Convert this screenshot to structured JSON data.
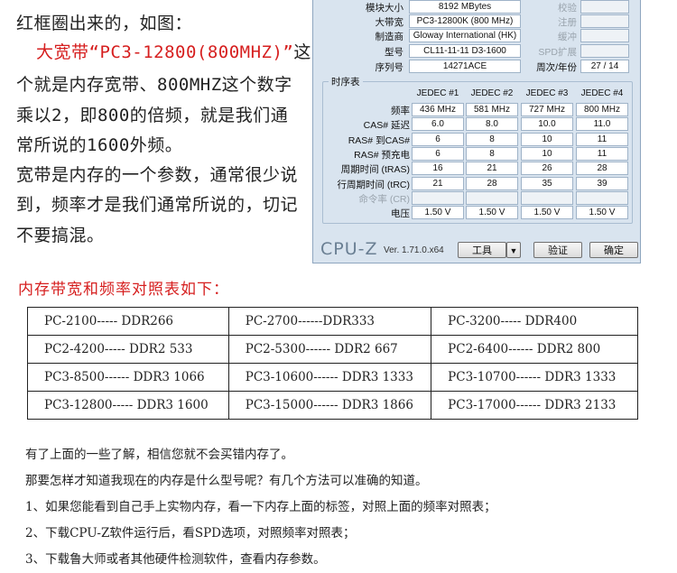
{
  "intro": {
    "line1": "红框圈出来的，如图：",
    "line2_highlight": "大宽带",
    "line2_quote": "“PC3-12800(800MHZ)”",
    "line2_tail": "这",
    "line3": "个就是内存宽带、800MHZ这个数字",
    "line4": "乘以2，即800的倍频，就是我们通",
    "line5": "常所说的1600外频。",
    "line6": "宽带是内存的一个参数，通常很少说",
    "line7": "到，频率才是我们通常所说的，切记",
    "line8": "不要搞混。"
  },
  "cpuz": {
    "module_size_label": "模块大小",
    "module_size": "8192 MBytes",
    "check_label": "校验",
    "bandwidth_label": "大带宽",
    "bandwidth": "PC3-12800K (800 MHz)",
    "register_label": "注册",
    "manufacturer_label": "制造商",
    "manufacturer": "Gloway International (HK)",
    "buffer_label": "缓冲",
    "part_label": "型号",
    "part_number": "CL11-11-11 D3-1600",
    "spd_ext_label": "SPD扩展",
    "serial_label": "序列号",
    "serial": "14271ACE",
    "week_year_label": "周次/年份",
    "week_year": "27 / 14",
    "timings_title": "时序表",
    "timing_headers": [
      "JEDEC #1",
      "JEDEC #2",
      "JEDEC #3",
      "JEDEC #4"
    ],
    "timing_rows": [
      {
        "label": "频率",
        "values": [
          "436 MHz",
          "581 MHz",
          "727 MHz",
          "800 MHz"
        ]
      },
      {
        "label": "CAS# 延迟",
        "values": [
          "6.0",
          "8.0",
          "10.0",
          "11.0"
        ]
      },
      {
        "label": "RAS# 到CAS#",
        "values": [
          "6",
          "8",
          "10",
          "11"
        ]
      },
      {
        "label": "RAS# 预充电",
        "values": [
          "6",
          "8",
          "10",
          "11"
        ]
      },
      {
        "label": "周期时间 (tRAS)",
        "values": [
          "16",
          "21",
          "26",
          "28"
        ]
      },
      {
        "label": "行周期时间 (tRC)",
        "values": [
          "21",
          "28",
          "35",
          "39"
        ]
      },
      {
        "label": "命令率 (CR)",
        "values": [
          "",
          "",
          "",
          ""
        ]
      },
      {
        "label": "电压",
        "values": [
          "1.50 V",
          "1.50 V",
          "1.50 V",
          "1.50 V"
        ]
      }
    ],
    "brand": "CPU-Z",
    "version": "Ver. 1.71.0.x64",
    "tools_button": "工具",
    "dropdown_arrow": "▼",
    "validate_button": "验证",
    "ok_button": "确定"
  },
  "section_title": "内存带宽和频率对照表如下：",
  "table": [
    [
      "PC-2100----- DDR266",
      "PC-2700------DDR333",
      "PC-3200----- DDR400"
    ],
    [
      "PC2-4200----- DDR2 533",
      "PC2-5300------ DDR2 667",
      "PC2-6400------ DDR2 800"
    ],
    [
      "PC3-8500------ DDR3 1066",
      "PC3-10600------ DDR3 1333",
      "PC3-10700------ DDR3 1333"
    ],
    [
      "PC3-12800----- DDR3 1600",
      "PC3-15000------ DDR3 1866",
      "PC3-17000------ DDR3 2133"
    ]
  ],
  "notes": [
    "有了上面的一些了解，相信您就不会买错内存了。",
    "那要怎样才知道我现在的内存是什么型号呢？有几个方法可以准确的知道。",
    "1、如果您能看到自己手上实物内存，看一下内存上面的标签，对照上面的频率对照表；",
    "2、下载CPU-Z软件运行后，看SPD选项，对照频率对照表；",
    "3、下载鲁大师或者其他硬件检测软件，查看内存参数。"
  ]
}
